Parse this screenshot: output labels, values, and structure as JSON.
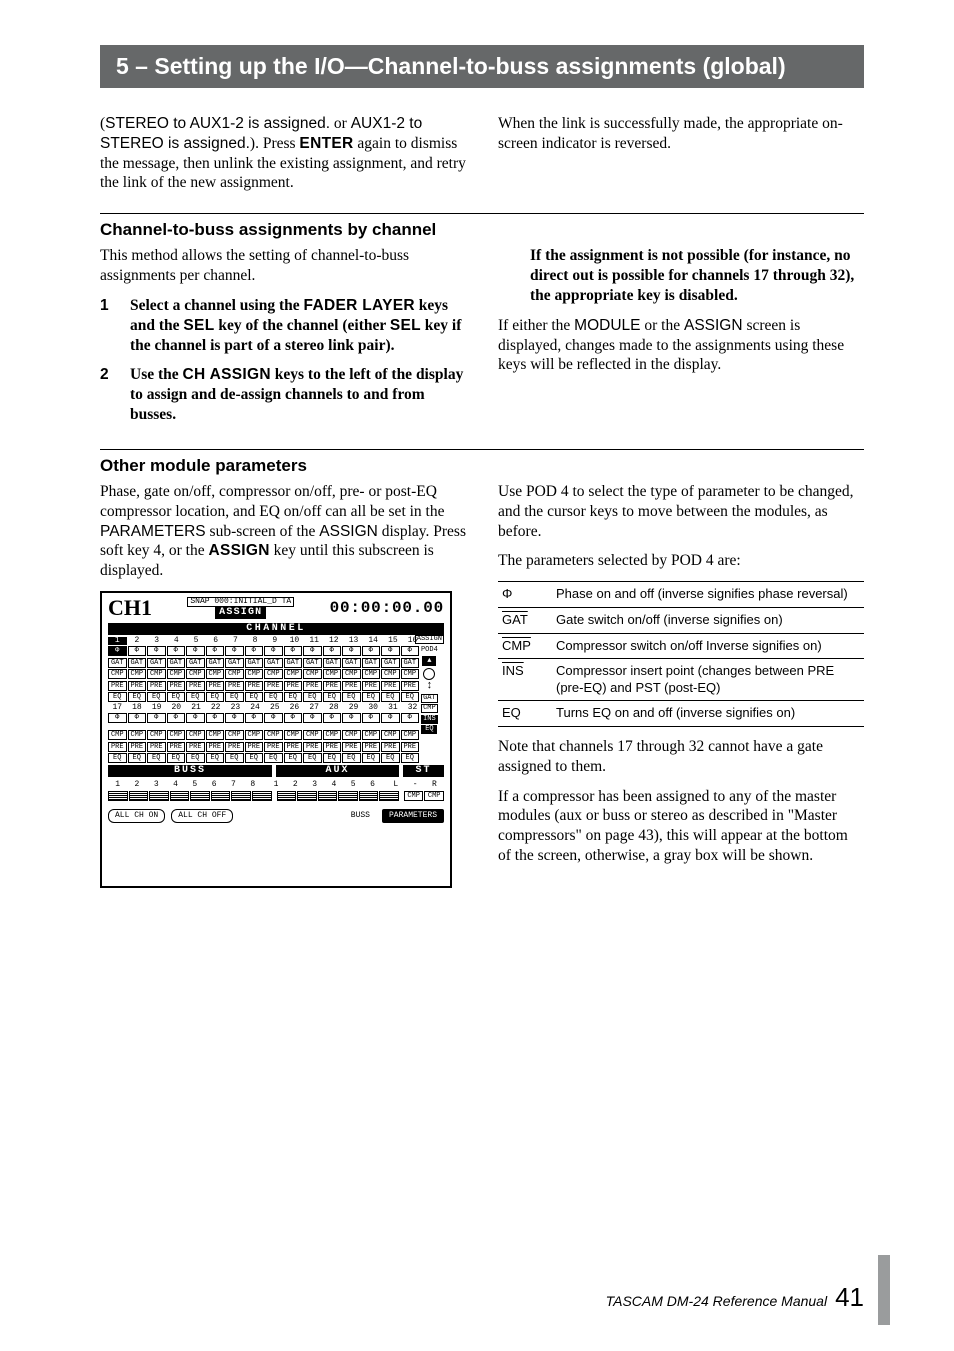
{
  "header": {
    "title": "5 – Setting up the I/O—Channel-to-buss assignments (global)"
  },
  "intro": {
    "left": "(STEREO to AUX1-2 is assigned. or AUX1-2 to STEREO is assigned.). Press ENTER again to dismiss the message, then unlink the existing assignment, and retry the link of the new assignment.",
    "right": "When the link is successfully made, the appropriate on-screen indicator is reversed."
  },
  "section1": {
    "heading": "Channel-to-buss assignments by channel",
    "left_intro": "This method allows the setting of channel-to-buss assignments per channel.",
    "steps": [
      {
        "n": "1",
        "text": "Select a channel using the FADER LAYER keys and the SEL key of the channel (either SEL key if the channel is part of a stereo link pair)."
      },
      {
        "n": "2",
        "text": "Use the CH ASSIGN keys to the left of the display to assign and de-assign channels to and from busses."
      }
    ],
    "right_warning": "If the assignment is not possible (for instance, no direct out is possible for channels 17 through 32), the appropriate key is disabled.",
    "right_body": "If either the MODULE or the ASSIGN screen is displayed, changes made to the assignments using these keys will be reflected in the display."
  },
  "section2": {
    "heading": "Other module parameters",
    "left_p1": "Phase, gate on/off, compressor on/off, pre- or post-EQ compressor location, and EQ on/off can all be set in the PARAMETERS sub-screen of the ASSIGN display. Press soft key 4, or the ASSIGN key until this subscreen is displayed.",
    "right_p1": "Use POD 4 to select the type of parameter to be changed, and the cursor keys to move between the modules, as before.",
    "right_p2": "The parameters selected by POD 4 are:",
    "table": [
      {
        "code": "Φ",
        "desc": "Phase on and off (inverse signifies phase reversal)"
      },
      {
        "code": "GAT",
        "desc": "Gate switch on/off (inverse signifies on)"
      },
      {
        "code": "CMP",
        "desc": "Compressor switch on/off Inverse signifies on)"
      },
      {
        "code": "INS",
        "desc": "Compressor insert point (changes between PRE (pre-EQ) and PST (post-EQ)"
      },
      {
        "code": "EQ",
        "desc": "Turns EQ on and off (inverse signifies on)"
      }
    ],
    "right_p3": "Note that channels 17 through 32 cannot have a gate assigned to them.",
    "right_p4": "If a compressor has been assigned to any of the master modules (aux or buss or stereo as described in \"Master compressors\" on page 43), this will appear at the bottom of the screen, otherwise, a gray box will be shown."
  },
  "figure": {
    "channel_label": "CH1",
    "top_tag": "SNAP 000:INITIAL_D TA",
    "mode": "ASSIGN",
    "timecode": "00:00:00.00",
    "channel_bar": "CHANNEL",
    "side": {
      "assign": "ASSIGN",
      "pod": "POD4",
      "tags": [
        "GAT",
        "CMP",
        "INS",
        "EQ"
      ]
    },
    "nums_top": [
      "1",
      "2",
      "3",
      "4",
      "5",
      "6",
      "7",
      "8",
      "9",
      "10",
      "11",
      "12",
      "13",
      "14",
      "15",
      "16"
    ],
    "rows_top": [
      "Φ",
      "GAT",
      "CMP",
      "PRE",
      "EQ"
    ],
    "nums_mid": [
      "17",
      "18",
      "19",
      "20",
      "21",
      "22",
      "23",
      "24",
      "25",
      "26",
      "27",
      "28",
      "29",
      "30",
      "31",
      "32"
    ],
    "rows_mid": [
      "Φ",
      "CMP",
      "PRE",
      "EQ"
    ],
    "sections": {
      "buss": "BUSS",
      "aux": "AUX",
      "st": "ST"
    },
    "nums_bottom_buss": [
      "1",
      "2",
      "3",
      "4",
      "5",
      "6",
      "7",
      "8"
    ],
    "nums_bottom_aux": [
      "1",
      "2",
      "3",
      "4",
      "5",
      "6"
    ],
    "nums_bottom_st": [
      "L",
      "-",
      "R"
    ],
    "cmp_tags": [
      "CMP",
      "CMP"
    ],
    "soft_buttons": [
      "ALL CH ON",
      "ALL CH OFF",
      "BUSS",
      "PARAMETERS"
    ]
  },
  "footer": {
    "manual": "TASCAM DM-24 Reference Manual",
    "page": "41"
  }
}
